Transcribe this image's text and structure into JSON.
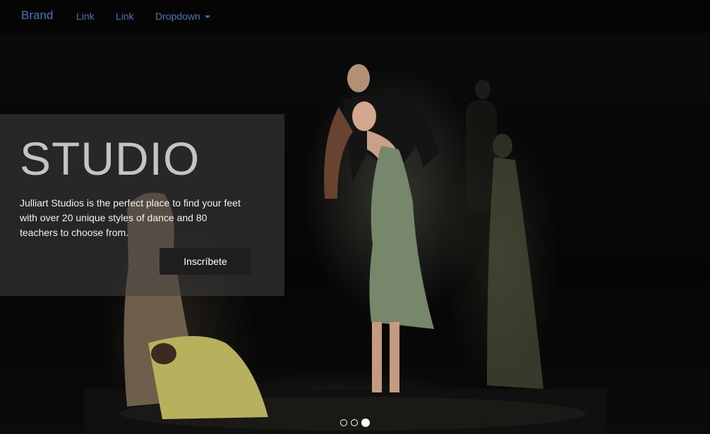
{
  "navbar": {
    "brand": "Brand",
    "links": [
      "Link",
      "Link"
    ],
    "dropdown": "Dropdown",
    "link_color": "#3f78b8",
    "background": "#050505"
  },
  "carousel": {
    "title": "STUDIO",
    "text": "Julliart Studios is the perfect place to find your feet with over 20 unique styles of dance and 80 teachers to choose from.",
    "button": "Inscríbete",
    "indicator_count": 3,
    "active_indicator": 3,
    "image_subject": "dancers on a dark stage"
  }
}
